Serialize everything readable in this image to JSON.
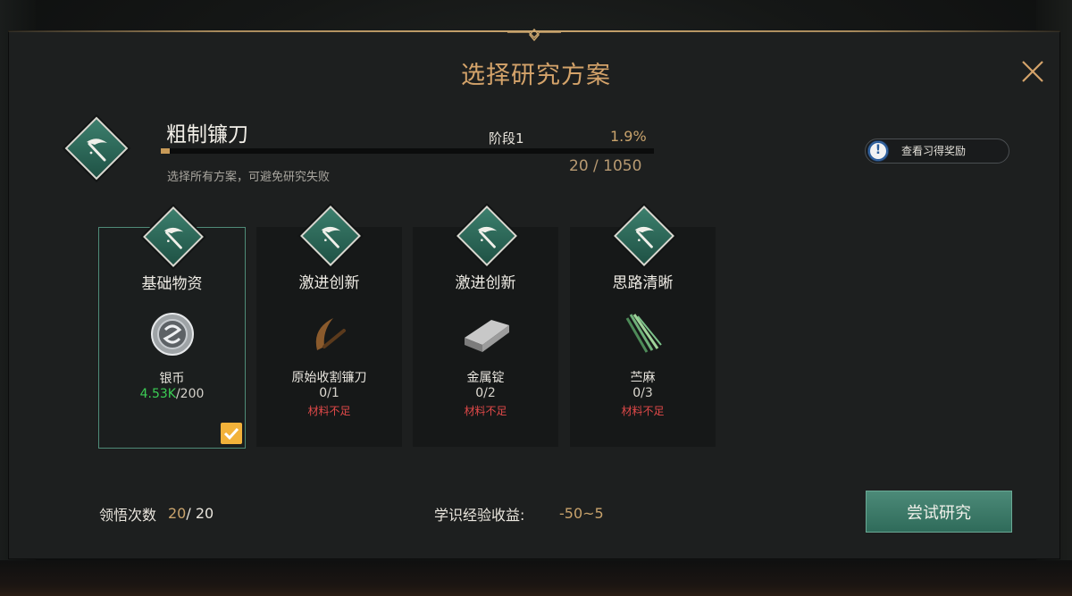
{
  "dialog": {
    "title": "选择研究方案",
    "close_icon": "close-icon"
  },
  "research": {
    "name": "粗制镰刀",
    "stage_label": "阶段1",
    "percent": "1.9%",
    "progress_fraction": 0.019,
    "count": "20 / 1050",
    "hint": "选择所有方案，可避免研究失败",
    "icon": "scythe-icon"
  },
  "reward_button": {
    "label": "查看习得奖励",
    "icon": "info-icon"
  },
  "cards": [
    {
      "title": "基础物资",
      "item_name": "银币",
      "have": "4.53K",
      "need": "/200",
      "sufficient": true,
      "warning": "",
      "selected": true,
      "item_icon": "silver-coin-icon"
    },
    {
      "title": "激进创新",
      "item_name": "原始收割镰刀",
      "have": "0",
      "need": "/1",
      "sufficient": false,
      "warning": "材料不足",
      "selected": false,
      "item_icon": "sickle-icon"
    },
    {
      "title": "激进创新",
      "item_name": "金属锭",
      "have": "0",
      "need": "/2",
      "sufficient": false,
      "warning": "材料不足",
      "selected": false,
      "item_icon": "metal-ingot-icon"
    },
    {
      "title": "思路清晰",
      "item_name": "苎麻",
      "have": "0",
      "need": "/3",
      "sufficient": false,
      "warning": "材料不足",
      "selected": false,
      "item_icon": "ramie-icon"
    }
  ],
  "footer": {
    "attempts_label": "领悟次数",
    "attempts_current": "20",
    "attempts_total": "/ 20",
    "exp_label": "学识经验收益:",
    "exp_value": "-50~5",
    "try_button": "尝试研究"
  },
  "colors": {
    "accent_gold": "#d4a36a",
    "teal": "#3c7f6d",
    "ok_green": "#3bcc54",
    "warn_red": "#e04949",
    "check_orange": "#f2b23a"
  }
}
